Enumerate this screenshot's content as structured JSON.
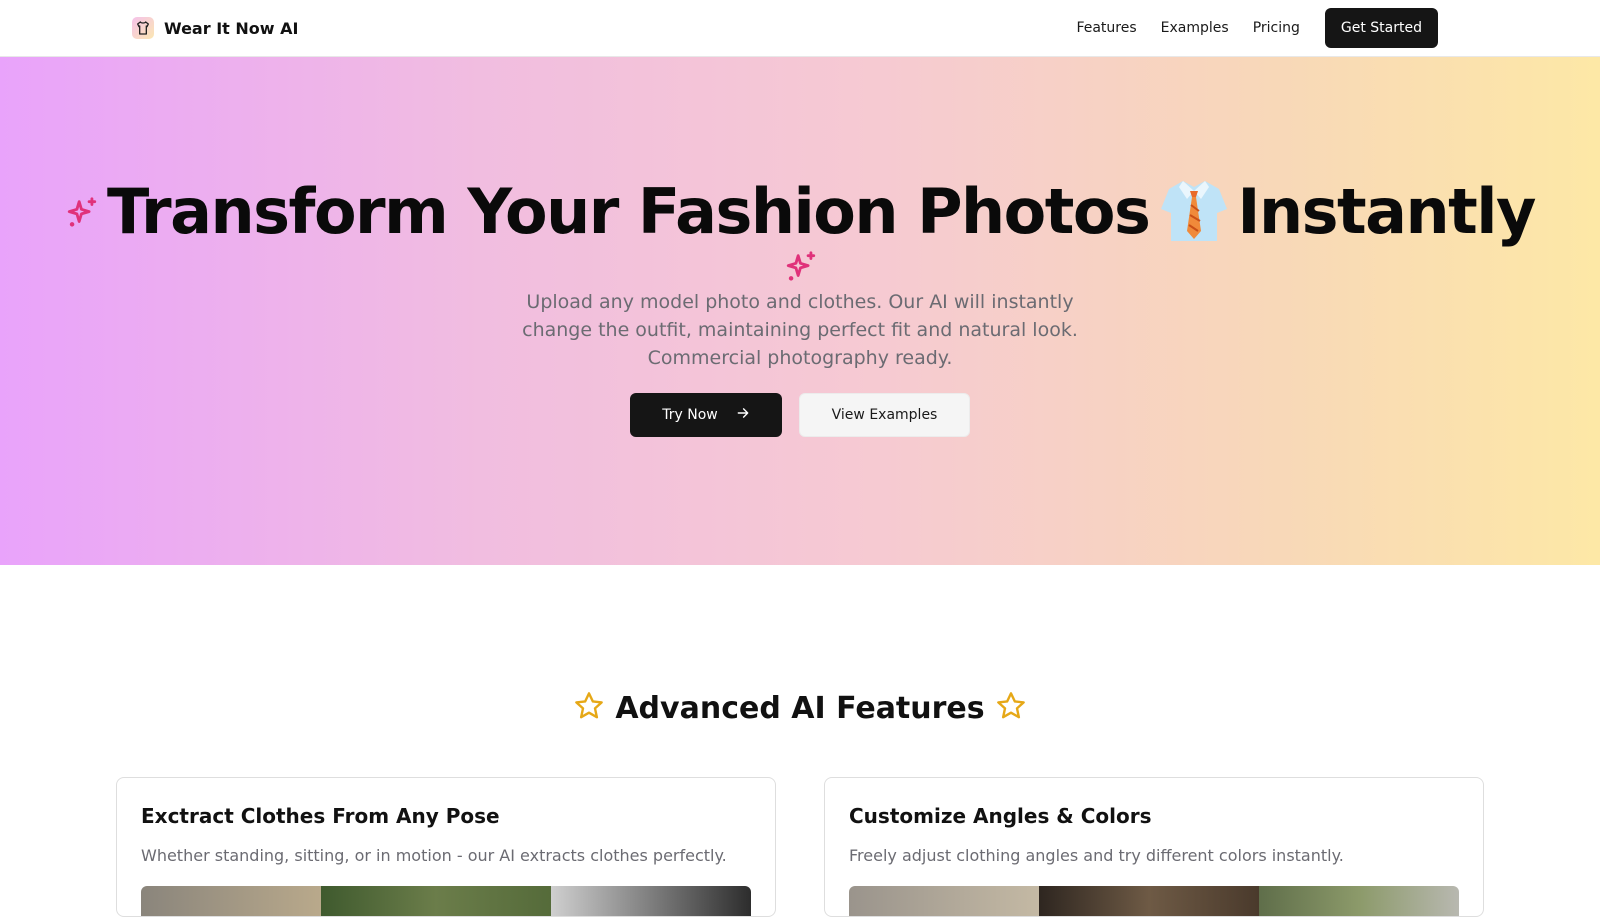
{
  "brand": {
    "name": "Wear It Now AI",
    "logo_icon": "shirt-icon"
  },
  "nav": {
    "links": [
      "Features",
      "Examples",
      "Pricing"
    ],
    "cta": "Get Started"
  },
  "hero": {
    "title_part1": "Transform Your Fashion Photos",
    "title_part2": "Instantly",
    "title_icons": [
      "sparkles-icon",
      "shirt-tie-icon",
      "sparkles-icon"
    ],
    "subtitle": "Upload any model photo and clothes. Our AI will instantly change the outfit, maintaining perfect fit and natural look. Commercial photography ready.",
    "primary_button": "Try Now",
    "secondary_button": "View Examples",
    "gradient": [
      "#e9a3fb",
      "#f6cad2",
      "#fde8a6"
    ]
  },
  "features": {
    "heading": "Advanced AI Features",
    "heading_icons": [
      "star-icon",
      "star-icon"
    ],
    "cards": [
      {
        "title": "Exctract Clothes From Any Pose",
        "description": "Whether standing, sitting, or in motion - our AI extracts clothes perfectly."
      },
      {
        "title": "Customize Angles & Colors",
        "description": "Freely adjust clothing angles and try different colors instantly."
      }
    ]
  },
  "colors": {
    "accent_sparkle": "#e0317a",
    "star": "#e6a817",
    "dark_button": "#151515"
  }
}
